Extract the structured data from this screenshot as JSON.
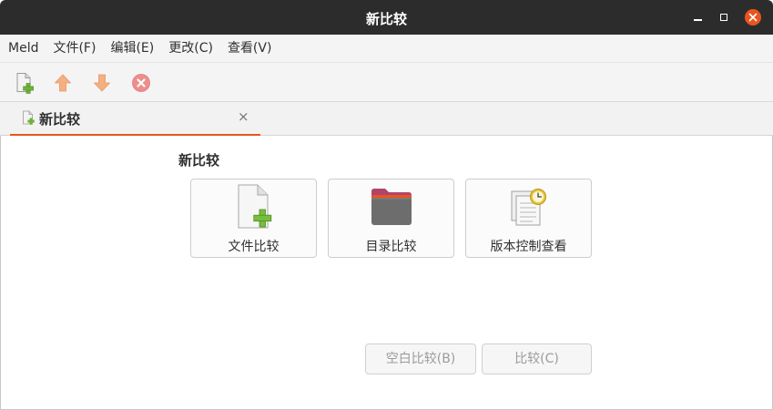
{
  "window": {
    "title": "新比较"
  },
  "menubar": {
    "items": [
      "Meld",
      "文件(F)",
      "编辑(E)",
      "更改(C)",
      "查看(V)"
    ]
  },
  "toolbar": {
    "buttons": [
      "new-comparison-icon",
      "previous-change-icon",
      "next-change-icon",
      "stop-icon"
    ]
  },
  "tab": {
    "label": "新比较",
    "close_glyph": "×",
    "accent_color": "#e95420"
  },
  "main": {
    "section_title": "新比较",
    "cards": [
      {
        "label": "文件比较",
        "icon": "file-compare-icon"
      },
      {
        "label": "目录比较",
        "icon": "folder-compare-icon"
      },
      {
        "label": "版本控制查看",
        "icon": "version-control-icon"
      }
    ],
    "blank_button": "空白比较(B)",
    "compare_button": "比较(C)"
  }
}
